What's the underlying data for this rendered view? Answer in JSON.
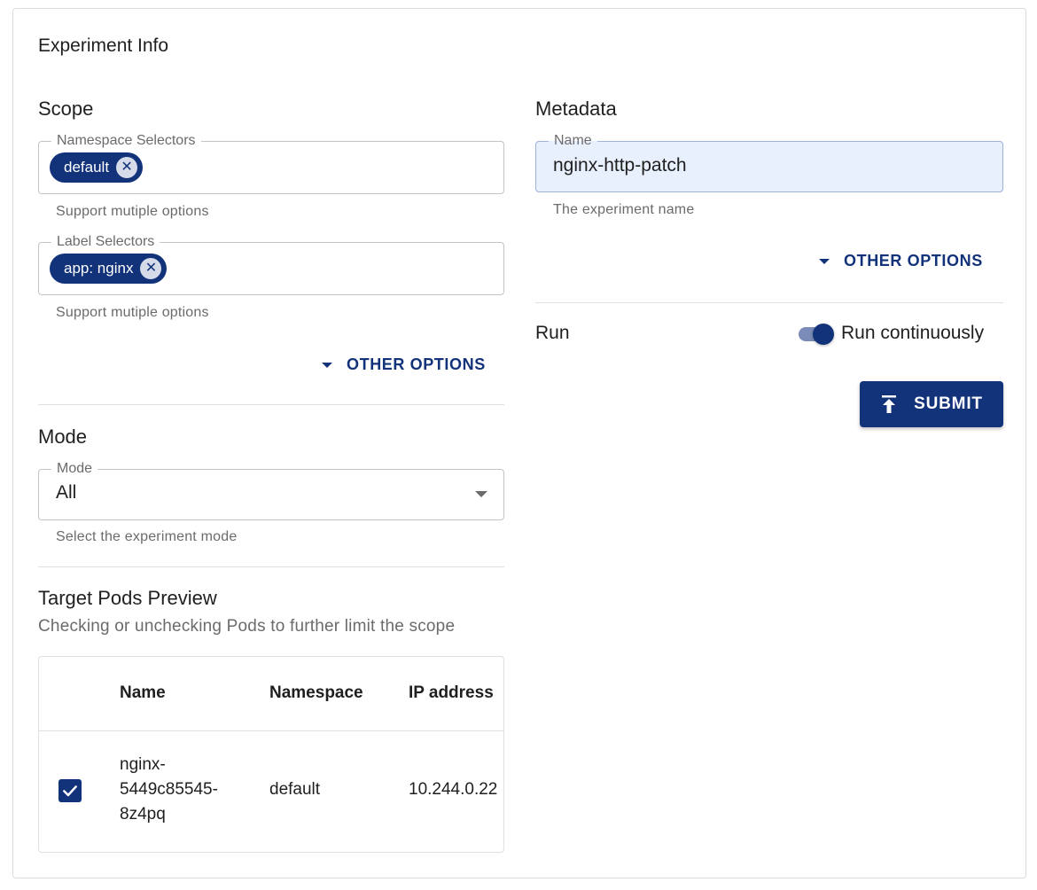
{
  "card": {
    "title": "Experiment Info"
  },
  "scope": {
    "title": "Scope",
    "namespace": {
      "legend": "Namespace Selectors",
      "chip": "default",
      "helper": "Support mutiple options"
    },
    "labels": {
      "legend": "Label Selectors",
      "chip": "app: nginx",
      "helper": "Support mutiple options"
    },
    "other_options": "OTHER OPTIONS"
  },
  "mode": {
    "title": "Mode",
    "legend": "Mode",
    "value": "All",
    "helper": "Select the experiment mode"
  },
  "preview": {
    "title": "Target Pods Preview",
    "subtitle": "Checking or unchecking Pods to further limit the scope",
    "columns": [
      "Name",
      "Namespace",
      "IP address"
    ],
    "rows": [
      {
        "checked": true,
        "name_lines": [
          "nginx-",
          "5449c85545-",
          "8z4pq"
        ],
        "namespace": "default",
        "ip": "10.244.0.22"
      }
    ]
  },
  "metadata": {
    "title": "Metadata",
    "legend": "Name",
    "value": "nginx-http-patch",
    "helper": "The experiment name",
    "other_options": "OTHER OPTIONS"
  },
  "run": {
    "label": "Run",
    "toggle_label": "Run continuously",
    "toggle_on": true
  },
  "submit": {
    "label": "SUBMIT"
  },
  "colors": {
    "primary": "#12327a",
    "filled_bg": "#e8f0fe"
  },
  "icons": {
    "chip_remove": "close-circle-icon",
    "dropdown": "caret-down-icon",
    "submit": "upload-icon",
    "checkbox": "check-icon"
  }
}
